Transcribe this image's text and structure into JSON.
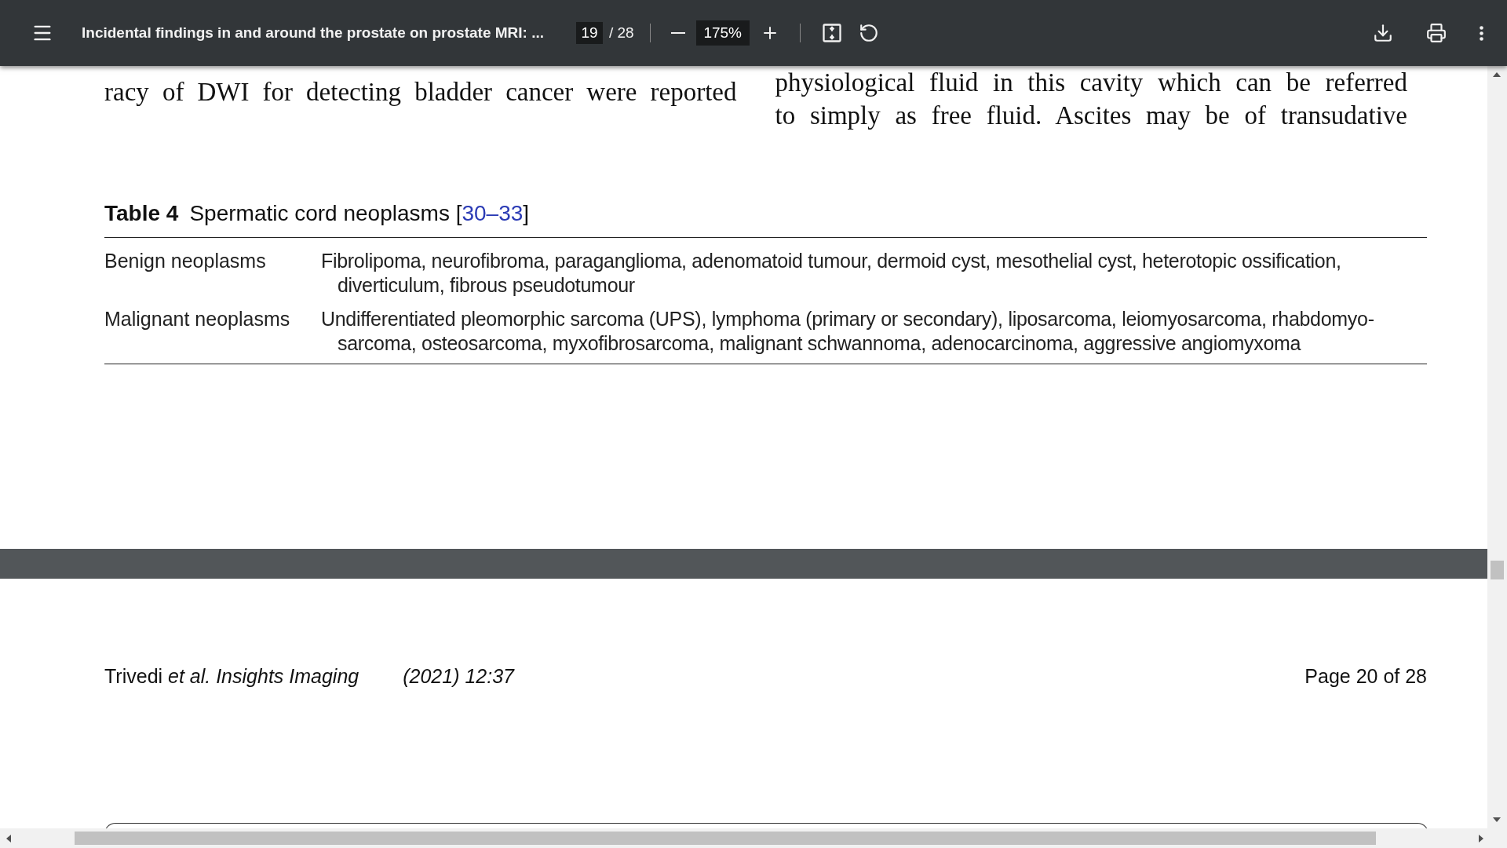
{
  "toolbar": {
    "title": "Incidental findings in and around the prostate on prostate MRI: ...",
    "page_current": "19",
    "page_total": "/ 28",
    "zoom": "175%"
  },
  "page_top": {
    "left_column": [
      "racy of DWI for detecting bladder cancer were reported"
    ],
    "right_column": [
      "physiological fluid in this cavity which can be referred",
      "to simply as free fluid. Ascites may be of transudative"
    ]
  },
  "table": {
    "label": "Table 4",
    "caption": "Spermatic cord neoplasms",
    "ref_open": "[",
    "reference": "30–33",
    "ref_close": "]",
    "rows": [
      {
        "category": "Benign neoplasms",
        "lines": [
          "Fibrolipoma, neurofibroma, paraganglioma, adenomatoid tumour, dermoid cyst, mesothelial cyst, heterotopic ossification,",
          "diverticulum, fibrous pseudotumour"
        ]
      },
      {
        "category": "Malignant neoplasms",
        "lines": [
          "Undifferentiated pleomorphic sarcoma (UPS), lymphoma (primary or secondary), liposarcoma, leiomyosarcoma, rhabdomyo-",
          "sarcoma, osteosarcoma, myxofibrosarcoma, malignant schwannoma, adenocarcinoma, aggressive angiomyxoma"
        ]
      }
    ]
  },
  "footer": {
    "citation": "Trivedi *et al. Insights Imaging*",
    "year": "(2021) 12:37",
    "page": "Page 20 of 28"
  }
}
